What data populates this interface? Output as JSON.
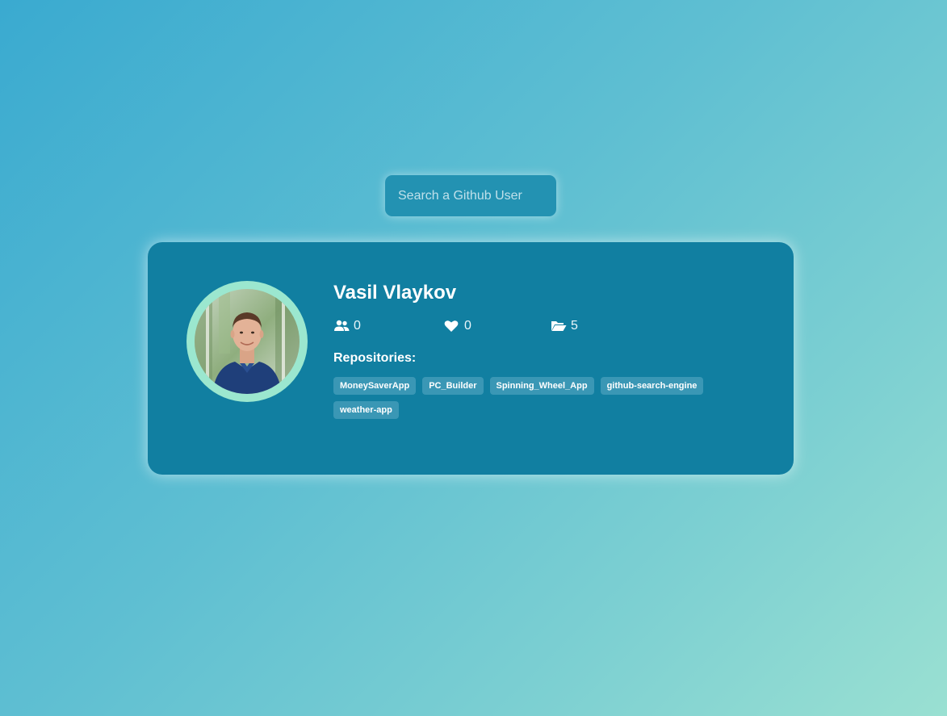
{
  "search": {
    "placeholder": "Search a Github User",
    "value": ""
  },
  "profile": {
    "name": "Vasil Vlaykov",
    "avatar_icon": "user-avatar-photo",
    "stats": {
      "followers": "0",
      "followers_icon": "users-icon",
      "following": "0",
      "following_icon": "heart-icon",
      "repos": "5",
      "repos_icon": "folder-open-icon"
    },
    "repos_heading": "Repositories:",
    "repos": [
      "MoneySaverApp",
      "PC_Builder",
      "Spinning_Wheel_App",
      "github-search-engine",
      "weather-app"
    ]
  },
  "colors": {
    "card": "#117fa1",
    "search_bg": "#2392b2",
    "avatar_ring": "#9be7cf",
    "repo_tag": "#3a97b5"
  }
}
